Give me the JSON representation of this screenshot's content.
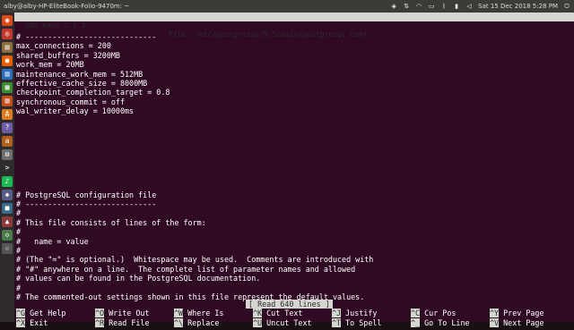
{
  "topbar": {
    "window_title": "alby@alby-HP-EliteBook-Folio-9470m: ~",
    "clock": "Sat 15 Dec 2018  5:28 PM"
  },
  "launcher": {
    "apps": [
      {
        "name": "ubuntu-icon",
        "glyph": "◉",
        "color": "#dd4814"
      },
      {
        "name": "chrome-icon",
        "glyph": "◎",
        "color": "#c7362a"
      },
      {
        "name": "files-icon",
        "glyph": "▤",
        "color": "#8a6d3b"
      },
      {
        "name": "firefox-icon",
        "glyph": "●",
        "color": "#e66000"
      },
      {
        "name": "writer-icon",
        "glyph": "▥",
        "color": "#2a6fbf"
      },
      {
        "name": "calc-icon",
        "glyph": "▦",
        "color": "#3c8d2f"
      },
      {
        "name": "impress-icon",
        "glyph": "▧",
        "color": "#c44d1a"
      },
      {
        "name": "software-center-icon",
        "glyph": "A",
        "color": "#e07a1f"
      },
      {
        "name": "help-icon",
        "glyph": "?",
        "color": "#6b5ca5"
      },
      {
        "name": "amazon-icon",
        "glyph": "a",
        "color": "#b05e1c"
      },
      {
        "name": "settings-icon",
        "glyph": "⚙",
        "color": "#6f6f6f"
      },
      {
        "name": "terminal-icon",
        "glyph": ">",
        "color": "#2d2d2d"
      },
      {
        "name": "spotify-icon",
        "glyph": "♪",
        "color": "#1db954"
      },
      {
        "name": "app-icon-14",
        "glyph": "◆",
        "color": "#5a5a8a"
      },
      {
        "name": "app-icon-15",
        "glyph": "■",
        "color": "#3a6a8a"
      },
      {
        "name": "app-icon-16",
        "glyph": "▲",
        "color": "#8a3a3a"
      },
      {
        "name": "app-icon-17",
        "glyph": "◇",
        "color": "#4a7a4a"
      },
      {
        "name": "trash-icon",
        "glyph": "♲",
        "color": "#555555"
      }
    ]
  },
  "nano": {
    "version": "GNU nano 2.5.3",
    "file": "File: /etc/postgresql/9.5/main/postgresql.conf",
    "lines": [
      "# -----------------------------",
      "max_connections = 200",
      "shared_buffers = 3200MB",
      "work_mem = 20MB",
      "maintenance_work_mem = 512MB",
      "effective_cache_size = 8000MB",
      "checkpoint_completion_target = 0.8",
      "synchronous_commit = off",
      "wal_writer_delay = 10000ms",
      "",
      "",
      "",
      "",
      "",
      "",
      "",
      "",
      "# PostgreSQL configuration file",
      "# -----------------------------",
      "#",
      "# This file consists of lines of the form:",
      "#",
      "#   name = value",
      "#",
      "# (The \"=\" is optional.)  Whitespace may be used.  Comments are introduced with",
      "# \"#\" anywhere on a line.  The complete list of parameter names and allowed",
      "# values can be found in the PostgreSQL documentation.",
      "#",
      "# The commented-out settings shown in this file represent the default values."
    ],
    "status": "[ Read 640 lines ]",
    "shortcuts": [
      {
        "key": "^G",
        "label": "Get Help"
      },
      {
        "key": "^X",
        "label": "Exit"
      },
      {
        "key": "^O",
        "label": "Write Out"
      },
      {
        "key": "^R",
        "label": "Read File"
      },
      {
        "key": "^W",
        "label": "Where Is"
      },
      {
        "key": "^\\",
        "label": "Replace"
      },
      {
        "key": "^K",
        "label": "Cut Text"
      },
      {
        "key": "^U",
        "label": "Uncut Text"
      },
      {
        "key": "^J",
        "label": "Justify"
      },
      {
        "key": "^T",
        "label": "To Spell"
      },
      {
        "key": "^C",
        "label": "Cur Pos"
      },
      {
        "key": "^_",
        "label": "Go To Line"
      },
      {
        "key": "^Y",
        "label": "Prev Page"
      },
      {
        "key": "^V",
        "label": "Next Page"
      }
    ]
  }
}
